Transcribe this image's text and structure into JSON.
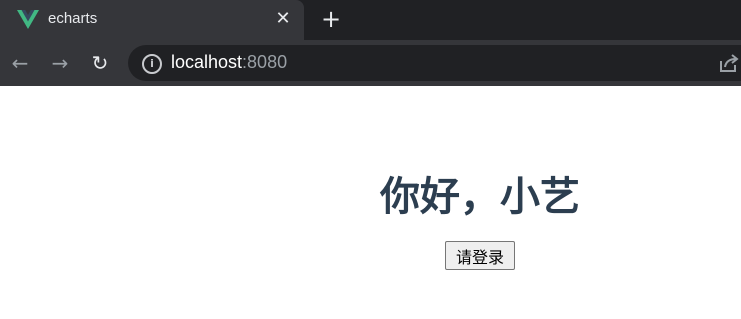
{
  "browser": {
    "tab": {
      "title": "echarts",
      "favicon": "vue-logo-icon",
      "close_glyph": "✕"
    },
    "new_tab_glyph": "+",
    "nav": {
      "back_glyph": "←",
      "forward_glyph": "→",
      "reload_glyph": "↻"
    },
    "address": {
      "host": "localhost",
      "port": ":8080",
      "info_glyph": "i"
    },
    "colors": {
      "chrome_dark": "#202124",
      "chrome_tab": "#35363a",
      "vue_green": "#41b883",
      "vue_dark": "#35495e"
    }
  },
  "page": {
    "greeting": "你好，小艺",
    "login_button": "请登录",
    "colors": {
      "heading": "#2c3e50"
    }
  }
}
